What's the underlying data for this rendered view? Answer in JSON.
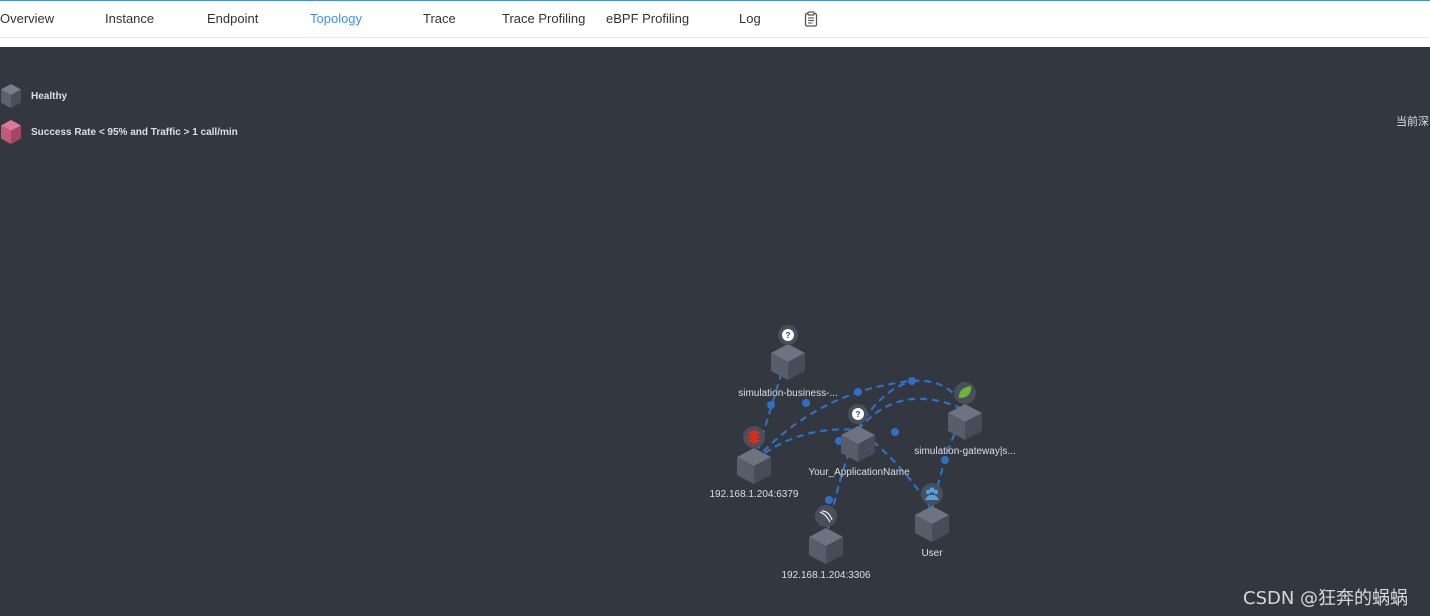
{
  "tabs": [
    {
      "id": "overview",
      "label": "Overview"
    },
    {
      "id": "instance",
      "label": "Instance"
    },
    {
      "id": "endpoint",
      "label": "Endpoint"
    },
    {
      "id": "topology",
      "label": "Topology",
      "active": true
    },
    {
      "id": "trace",
      "label": "Trace"
    },
    {
      "id": "trace-profiling",
      "label": "Trace Profiling"
    },
    {
      "id": "ebpf-profiling",
      "label": "eBPF Profiling"
    },
    {
      "id": "log",
      "label": "Log"
    }
  ],
  "toolbar": {
    "clipboard_icon": "clipboard-icon"
  },
  "legend": [
    {
      "label": "Healthy",
      "color": "#5b6170"
    },
    {
      "label": "Success Rate < 95% and Traffic > 1 call/min",
      "color": "#c3587a"
    }
  ],
  "side_note": "当前深",
  "nodes": [
    {
      "id": "simulation-business",
      "label": "simulation-business-...",
      "icon": "question-icon"
    },
    {
      "id": "redis",
      "label": "192.168.1.204:6379",
      "icon": "redis-icon"
    },
    {
      "id": "your-app",
      "label": "Your_ApplicationName",
      "icon": "question-icon"
    },
    {
      "id": "gateway",
      "label": "simulation-gateway|s...",
      "icon": "spring-leaf-icon"
    },
    {
      "id": "user",
      "label": "User",
      "icon": "users-icon"
    },
    {
      "id": "mysql",
      "label": "192.168.1.204:3306",
      "icon": "mysql-dolphin-icon"
    }
  ],
  "watermark": "CSDN @狂奔的蜗蜗",
  "colors": {
    "accent": "#448dfe",
    "canvas": "#333840",
    "edge": "#2f6fc4"
  }
}
